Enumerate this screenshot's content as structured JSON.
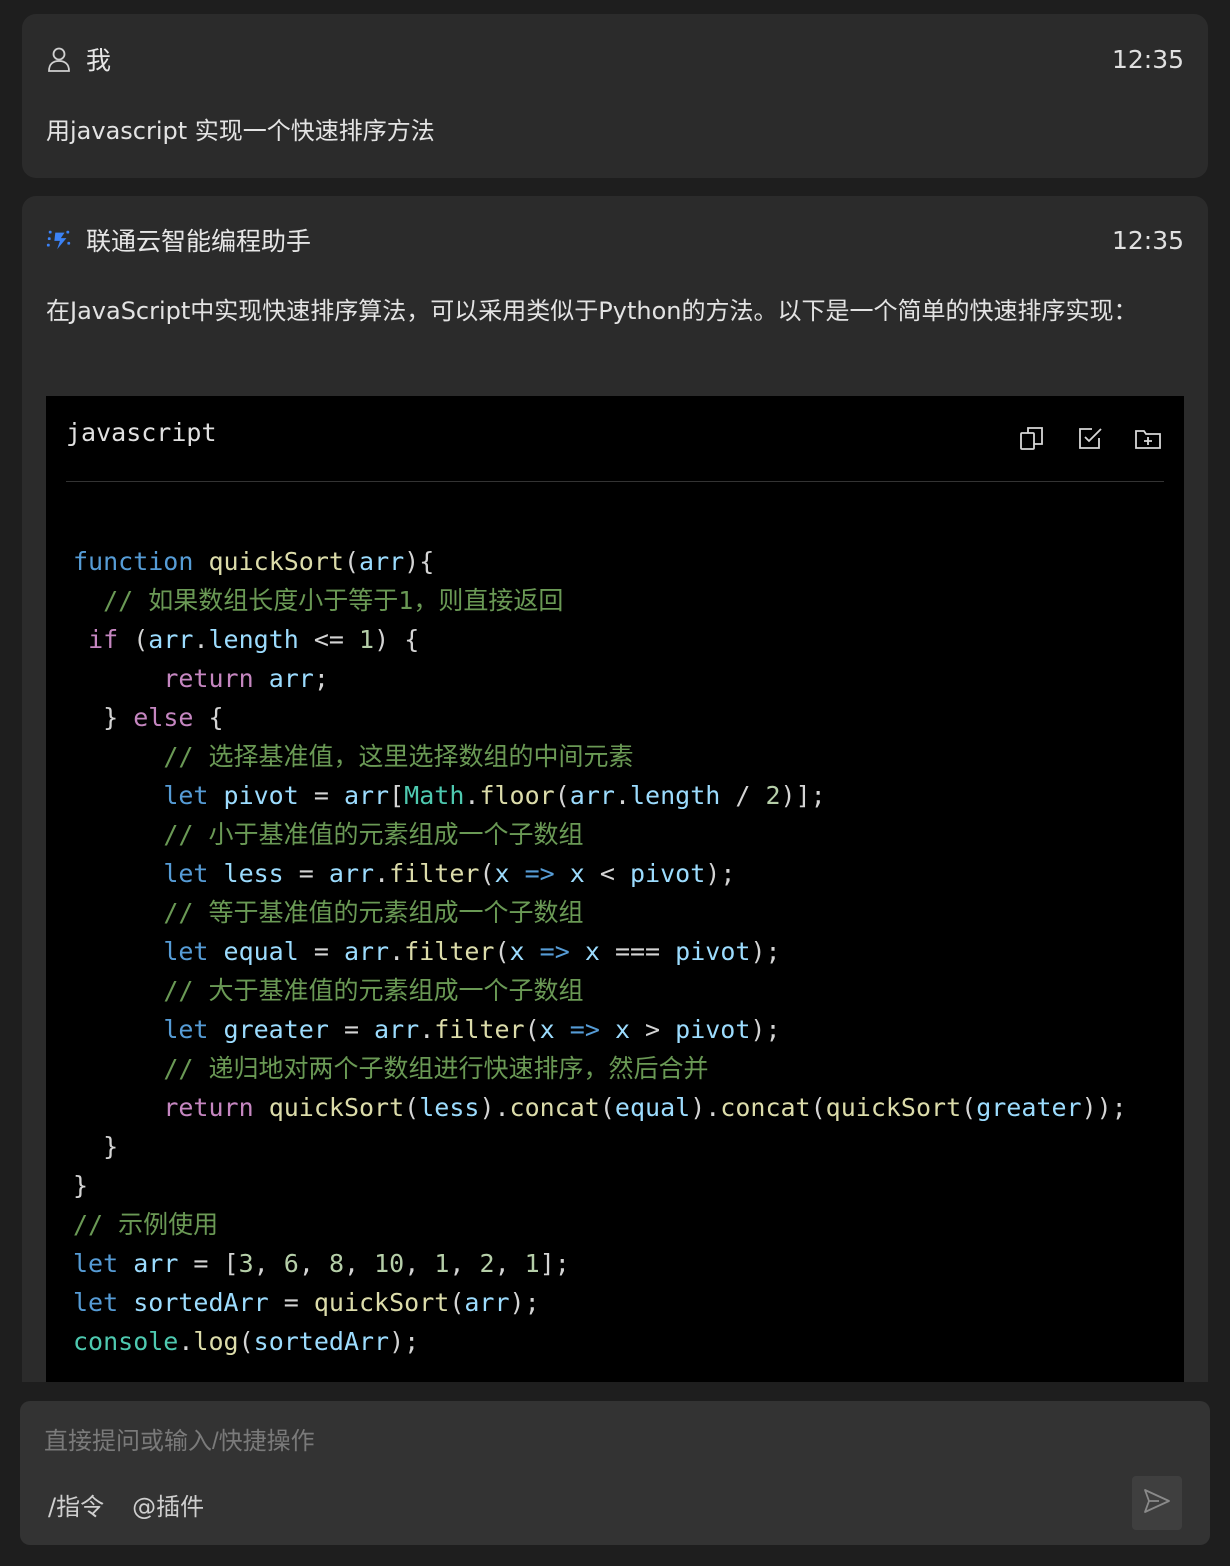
{
  "user_message": {
    "sender": "我",
    "time": "12:35",
    "text": "用javascript 实现一个快速排序方法"
  },
  "assistant_message": {
    "sender": "联通云智能编程助手",
    "time": "12:35",
    "text": "在JavaScript中实现快速排序算法，可以采用类似于Python的方法。以下是一个简单的快速排序实现：",
    "code_block": {
      "language": "javascript",
      "tool_icons": [
        "copy-icon",
        "insert-check-icon",
        "new-file-icon"
      ]
    }
  },
  "composer": {
    "placeholder": "直接提问或输入/快捷操作",
    "commands_label": "/指令",
    "plugins_label": "@插件"
  },
  "icons": {
    "user": "user-icon",
    "assistant": "assistant-logo-icon",
    "send": "send-icon"
  },
  "colors": {
    "accent": "#3b82f6",
    "background": "#1e1e1e",
    "card": "#2b2b2b",
    "code_bg": "#000000"
  }
}
